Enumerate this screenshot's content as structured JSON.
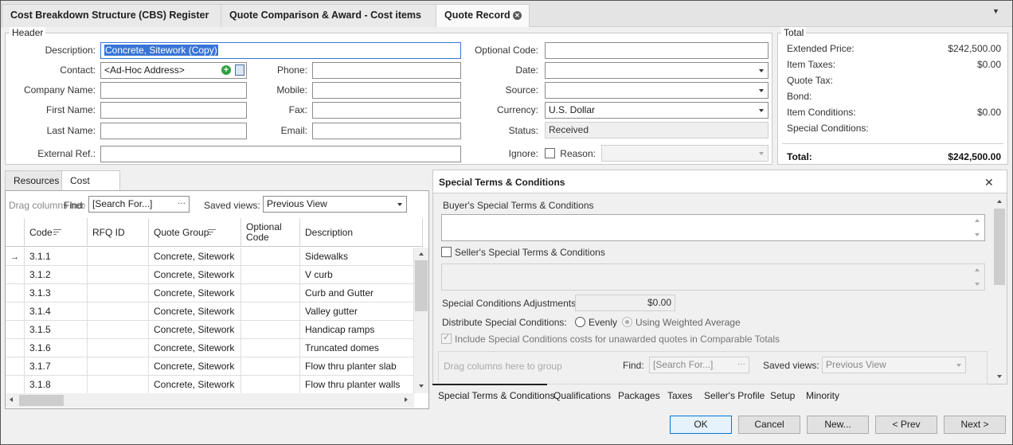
{
  "tabs": [
    {
      "label": "Cost Breakdown Structure (CBS) Register"
    },
    {
      "label": "Quote Comparison & Award - Cost items"
    },
    {
      "label": "Quote Record"
    }
  ],
  "header": {
    "title": "Header",
    "description_label": "Description:",
    "description_value": "Concrete, Sitework (Copy)",
    "contact_label": "Contact:",
    "contact_value": "<Ad-Hoc Address>",
    "company_label": "Company Name:",
    "first_label": "First Name:",
    "last_label": "Last Name:",
    "extref_label": "External Ref.:",
    "phone_label": "Phone:",
    "mobile_label": "Mobile:",
    "fax_label": "Fax:",
    "email_label": "Email:",
    "optcode_label": "Optional Code:",
    "date_label": "Date:",
    "source_label": "Source:",
    "currency_label": "Currency:",
    "currency_value": "U.S. Dollar",
    "status_label": "Status:",
    "status_value": "Received",
    "ignore_label": "Ignore:",
    "reason_label": "Reason:"
  },
  "totals": {
    "title": "Total",
    "rows": [
      {
        "label": "Extended Price:",
        "value": "$242,500.00"
      },
      {
        "label": "Item Taxes:",
        "value": "$0.00"
      },
      {
        "label": "Quote Tax:",
        "value": ""
      },
      {
        "label": "Bond:",
        "value": ""
      },
      {
        "label": "Item Conditions:",
        "value": "$0.00"
      },
      {
        "label": "Special Conditions:",
        "value": ""
      }
    ],
    "total_label": "Total:",
    "total_value": "$242,500.00"
  },
  "left_tabs": [
    {
      "label": "Resources"
    },
    {
      "label": "Cost Items"
    }
  ],
  "grid": {
    "drag_hint": "Drag columns here to",
    "find_label": "Find:",
    "search_placeholder": "[Search For...]",
    "more_btn": "···",
    "saved_views_label": "Saved views:",
    "saved_view_value": "Previous View",
    "columns": [
      "Code",
      "RFQ ID",
      "Quote Group",
      "Optional Code",
      "Description"
    ],
    "rows": [
      {
        "code": "3.1.1",
        "rfq": "",
        "group": "Concrete, Sitework",
        "opt": "",
        "desc": "Sidewalks"
      },
      {
        "code": "3.1.2",
        "rfq": "",
        "group": "Concrete, Sitework",
        "opt": "",
        "desc": "V curb"
      },
      {
        "code": "3.1.3",
        "rfq": "",
        "group": "Concrete, Sitework",
        "opt": "",
        "desc": "Curb and Gutter"
      },
      {
        "code": "3.1.4",
        "rfq": "",
        "group": "Concrete, Sitework",
        "opt": "",
        "desc": "Valley gutter"
      },
      {
        "code": "3.1.5",
        "rfq": "",
        "group": "Concrete, Sitework",
        "opt": "",
        "desc": "Handicap ramps"
      },
      {
        "code": "3.1.6",
        "rfq": "",
        "group": "Concrete, Sitework",
        "opt": "",
        "desc": "Truncated domes"
      },
      {
        "code": "3.1.7",
        "rfq": "",
        "group": "Concrete, Sitework",
        "opt": "",
        "desc": "Flow thru planter slab"
      },
      {
        "code": "3.1.8",
        "rfq": "",
        "group": "Concrete, Sitework",
        "opt": "",
        "desc": "Flow thru planter walls"
      }
    ]
  },
  "special": {
    "title": "Special Terms & Conditions",
    "buyer_label": "Buyer's Special Terms & Conditions",
    "seller_label": "Seller's Special Terms & Conditions",
    "adj_label": "Special Conditions Adjustments:",
    "adj_value": "$0.00",
    "distribute_label": "Distribute Special Conditions:",
    "evenly_label": "Evenly",
    "weighted_label": "Using Weighted Average",
    "include_label": "Include Special Conditions costs for unawarded quotes in Comparable Totals",
    "drag_hint": "Drag columns here to group",
    "find_label": "Find:",
    "search_placeholder": "[Search For...]",
    "more_btn": "···",
    "saved_views_label": "Saved views:",
    "saved_view_value": "Previous View"
  },
  "panel_tabs": [
    {
      "label": "Special Terms & Conditions"
    },
    {
      "label": "Qualifications"
    },
    {
      "label": "Packages"
    },
    {
      "label": "Taxes"
    },
    {
      "label": "Seller's Profile"
    },
    {
      "label": "Setup"
    },
    {
      "label": "Minority"
    }
  ],
  "buttons": {
    "ok": "OK",
    "cancel": "Cancel",
    "new": "New...",
    "prev": "< Prev",
    "next": "Next >"
  }
}
